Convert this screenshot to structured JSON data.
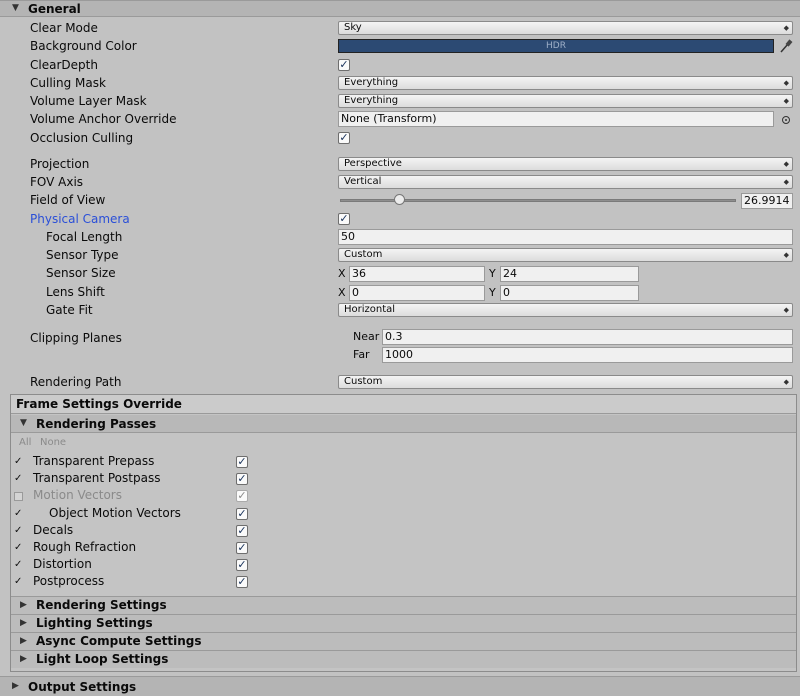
{
  "general": {
    "title": "General",
    "clear_mode": {
      "label": "Clear Mode",
      "value": "Sky"
    },
    "background_color": {
      "label": "Background Color",
      "badge": "HDR",
      "color": "#2c4a73"
    },
    "clear_depth": {
      "label": "ClearDepth",
      "checked": true
    },
    "culling_mask": {
      "label": "Culling Mask",
      "value": "Everything"
    },
    "volume_layer_mask": {
      "label": "Volume Layer Mask",
      "value": "Everything"
    },
    "volume_anchor_override": {
      "label": "Volume Anchor Override",
      "value": "None (Transform)"
    },
    "occlusion_culling": {
      "label": "Occlusion Culling",
      "checked": true
    },
    "projection": {
      "label": "Projection",
      "value": "Perspective"
    },
    "fov_axis": {
      "label": "FOV Axis",
      "value": "Vertical"
    },
    "field_of_view": {
      "label": "Field of View",
      "value": "26.9914",
      "slider_fraction": 0.15
    },
    "physical_camera": {
      "label": "Physical Camera",
      "checked": true
    },
    "focal_length": {
      "label": "Focal Length",
      "value": "50"
    },
    "sensor_type": {
      "label": "Sensor Type",
      "value": "Custom"
    },
    "sensor_size": {
      "label": "Sensor Size",
      "x_label": "X",
      "x": "36",
      "y_label": "Y",
      "y": "24"
    },
    "lens_shift": {
      "label": "Lens Shift",
      "x_label": "X",
      "x": "0",
      "y_label": "Y",
      "y": "0"
    },
    "gate_fit": {
      "label": "Gate Fit",
      "value": "Horizontal"
    },
    "clipping_planes": {
      "label": "Clipping Planes",
      "near_label": "Near",
      "near": "0.3",
      "far_label": "Far",
      "far": "1000"
    },
    "rendering_path": {
      "label": "Rendering Path",
      "value": "Custom"
    }
  },
  "frame_settings": {
    "title": "Frame Settings Override",
    "rendering_passes": {
      "title": "Rendering Passes",
      "all_label": "All",
      "none_label": "None",
      "items": [
        {
          "label": "Transparent Prepass",
          "override": true,
          "value": true,
          "enabled": true
        },
        {
          "label": "Transparent Postpass",
          "override": true,
          "value": true,
          "enabled": true
        },
        {
          "label": "Motion Vectors",
          "override": false,
          "value": true,
          "enabled": false
        },
        {
          "label": "Object Motion Vectors",
          "override": true,
          "value": true,
          "enabled": true
        },
        {
          "label": "Decals",
          "override": true,
          "value": true,
          "enabled": true
        },
        {
          "label": "Rough Refraction",
          "override": true,
          "value": true,
          "enabled": true
        },
        {
          "label": "Distortion",
          "override": true,
          "value": true,
          "enabled": true
        },
        {
          "label": "Postprocess",
          "override": true,
          "value": true,
          "enabled": true
        }
      ]
    },
    "sections": [
      "Rendering Settings",
      "Lighting Settings",
      "Async Compute Settings",
      "Light Loop Settings"
    ]
  },
  "output_settings": {
    "title": "Output Settings"
  },
  "icons": {
    "collapse": "▼",
    "expand": "▶",
    "dropdown": "◆",
    "check": "✓",
    "eyedropper": "eyedropper-icon",
    "object_picker": "target-icon"
  }
}
